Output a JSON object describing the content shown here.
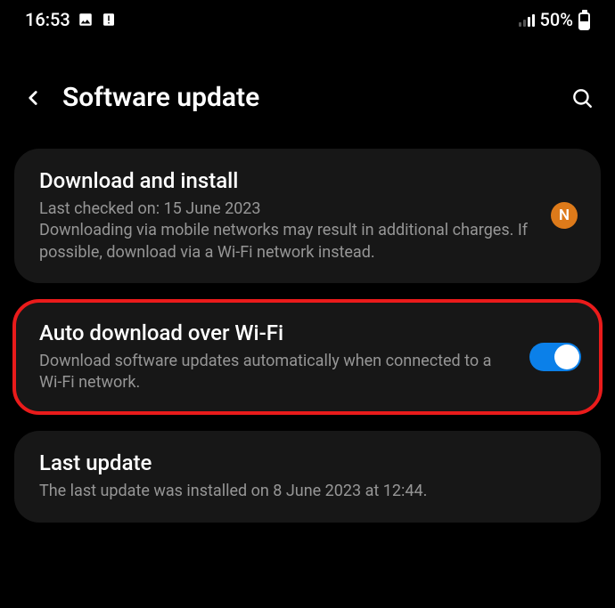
{
  "status": {
    "time": "16:53",
    "battery_pct": "50%"
  },
  "header": {
    "title": "Software update"
  },
  "cards": {
    "download": {
      "title": "Download and install",
      "sub1": "Last checked on: 15 June 2023",
      "sub2": "Downloading via mobile networks may result in additional charges. If possible, download via a Wi-Fi network instead.",
      "badge": "N"
    },
    "auto": {
      "title": "Auto download over Wi-Fi",
      "sub": "Download software updates automatically when connected to a Wi-Fi network."
    },
    "last": {
      "title": "Last update",
      "sub": "The last update was installed on 8 June 2023 at 12:44."
    }
  }
}
